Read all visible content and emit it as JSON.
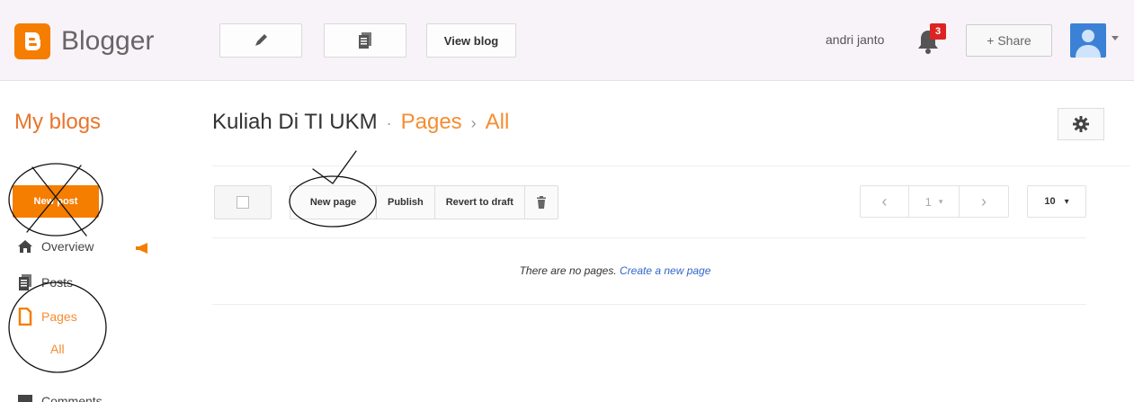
{
  "header": {
    "app_name": "Blogger",
    "view_blog_label": "View blog",
    "user_name": "andri janto",
    "notification_count": "3",
    "share_label": "+ Share",
    "brand_color": "#f57d00"
  },
  "title_row": {
    "my_blogs": "My blogs",
    "blog_name": "Kuliah Di TI UKM",
    "separator_dot": "·",
    "section": "Pages",
    "separator_arrow": "›",
    "subsection": "All"
  },
  "sidebar": {
    "new_post_label": "New post",
    "items": [
      {
        "label": "Overview",
        "icon": "home-icon"
      },
      {
        "label": "Posts",
        "icon": "posts-icon"
      },
      {
        "label": "Pages",
        "icon": "pages-icon",
        "active": true
      },
      {
        "label": "Comments",
        "icon": "comments-icon"
      }
    ],
    "pages_sub": "All"
  },
  "toolbar": {
    "new_page_label": "New page",
    "publish_label": "Publish",
    "revert_label": "Revert to draft",
    "page_number": "1",
    "per_page": "10"
  },
  "list": {
    "empty_text": "There are no pages.",
    "create_link": "Create a new page"
  }
}
